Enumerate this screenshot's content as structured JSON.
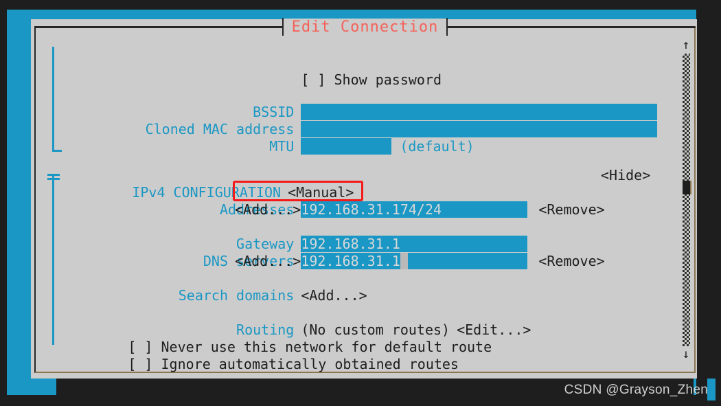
{
  "window": {
    "title": "Edit Connection",
    "title_color": "#f4625a"
  },
  "theme": {
    "background": "#1e1e1e",
    "accent_cyan": "#1a97c4",
    "dialog_bg": "#cccccc",
    "text_dark": "#1e1e1e",
    "field_text": "#d8d8d8",
    "annotation_red": "#f51a1a"
  },
  "form": {
    "show_password": {
      "checkbox": "[ ]",
      "label": "Show password",
      "checked": false
    },
    "wifi_fields": [
      {
        "label": "BSSID",
        "value": ""
      },
      {
        "label": "Cloned MAC address",
        "value": ""
      },
      {
        "label": "MTU",
        "value": "",
        "suffix": "(default)"
      }
    ],
    "ipv4": {
      "section_label": "IPv4 CONFIGURATION",
      "mode": "<Manual>",
      "hide_toggle": "<Hide>",
      "addresses_label": "Addresses",
      "addresses": [
        {
          "value": "192.168.31.174/24",
          "remove": "<Remove>"
        }
      ],
      "addresses_add": "<Add...>",
      "gateway_label": "Gateway",
      "gateway": "192.168.31.1",
      "dns_label": "DNS servers",
      "dns_servers": [
        {
          "value": "192.168.31.1",
          "remove": "<Remove>"
        }
      ],
      "dns_add": "<Add...>",
      "search_domains_label": "Search domains",
      "search_domains_add": "<Add...>",
      "routing_label": "Routing",
      "routing_value": "(No custom routes)",
      "routing_edit": "<Edit...>",
      "never_default_route": {
        "checkbox": "[ ]",
        "label": "Never use this network for default route",
        "checked": false
      },
      "ignore_auto_routes": {
        "checkbox": "[ ]",
        "label": "Ignore automatically obtained routes",
        "checked": false
      }
    }
  },
  "scrollbar": {
    "up_arrow": "↑",
    "down_arrow": "↓"
  },
  "watermark": {
    "text": "CSDN @Grayson_Zheng"
  }
}
